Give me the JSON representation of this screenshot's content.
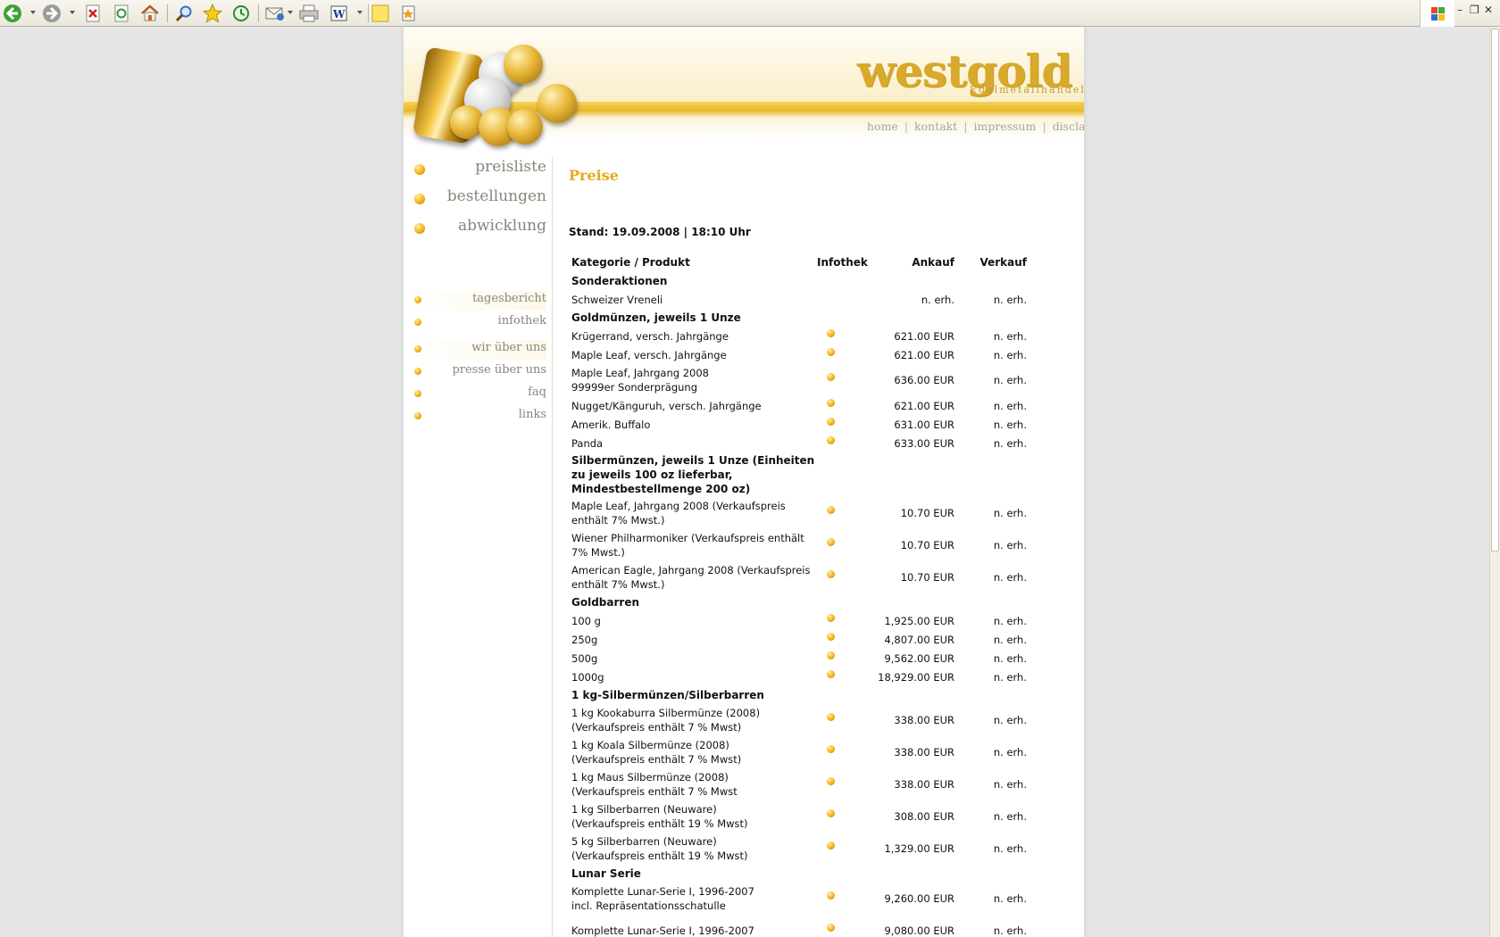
{
  "colors": {
    "accent": "#e4aa16",
    "nav_text": "#8a847a",
    "logo": "#d8a92a"
  },
  "toolbar": {
    "icons": [
      "back-icon",
      "forward-icon",
      "stop-icon",
      "refresh-icon",
      "home-icon",
      "search-icon",
      "favorites-icon",
      "history-icon",
      "mail-icon",
      "print-icon",
      "edit-icon",
      "note-icon",
      "research-icon"
    ]
  },
  "header": {
    "logo": "westgold",
    "logo_sub": "Edelmetallhandel",
    "topnav": [
      "home",
      "kontakt",
      "impressum",
      "disclaimer"
    ]
  },
  "leftnav": {
    "main": [
      "preisliste",
      "bestellungen",
      "abwicklung"
    ],
    "sub1": [
      "tagesbericht",
      "infothek"
    ],
    "sub2": [
      "wir über uns",
      "presse über uns",
      "faq",
      "links"
    ]
  },
  "content": {
    "title": "Preise",
    "stand": "Stand: 19.09.2008 | 18:10 Uhr",
    "columns": [
      "Kategorie / Produkt",
      "Infothek",
      "Ankauf",
      "Verkauf"
    ],
    "rows": [
      {
        "type": "cat",
        "product": "Sonderaktionen"
      },
      {
        "type": "item",
        "product": "Schweizer Vreneli",
        "info": false,
        "ankauf": "n. erh.",
        "verkauf": "n. erh."
      },
      {
        "type": "cat",
        "product": "Goldmünzen, jeweils 1 Unze"
      },
      {
        "type": "item",
        "product": "Krügerrand, versch. Jahrgänge",
        "info": true,
        "ankauf": "621.00 EUR",
        "verkauf": "n. erh."
      },
      {
        "type": "item",
        "product": "Maple Leaf, versch. Jahrgänge",
        "info": true,
        "ankauf": "621.00 EUR",
        "verkauf": "n. erh."
      },
      {
        "type": "item2",
        "product": "Maple Leaf, Jahrgang 2008\n99999er Sonderprägung",
        "info": true,
        "ankauf": "636.00 EUR",
        "verkauf": "n. erh."
      },
      {
        "type": "item",
        "product": "Nugget/Känguruh, versch. Jahrgänge",
        "info": true,
        "ankauf": "621.00 EUR",
        "verkauf": "n. erh."
      },
      {
        "type": "item",
        "product": "Amerik. Buffalo",
        "info": true,
        "ankauf": "631.00 EUR",
        "verkauf": "n. erh."
      },
      {
        "type": "item",
        "product": "Panda",
        "info": true,
        "ankauf": "633.00 EUR",
        "verkauf": "n. erh."
      },
      {
        "type": "cat3",
        "product": "Silbermünzen, jeweils 1 Unze (Einheiten\nzu jeweils 100 oz lieferbar,\nMindestbestellmenge 200 oz)"
      },
      {
        "type": "item2",
        "product": "Maple Leaf, Jahrgang 2008 (Verkaufspreis\nenthält 7% Mwst.)",
        "info": true,
        "ankauf": "10.70 EUR",
        "verkauf": "n. erh."
      },
      {
        "type": "item2",
        "product": "Wiener Philharmoniker (Verkaufspreis enthält\n7% Mwst.)",
        "info": true,
        "ankauf": "10.70 EUR",
        "verkauf": "n. erh."
      },
      {
        "type": "item2",
        "product": "American Eagle, Jahrgang 2008 (Verkaufspreis\nenthält 7% Mwst.)",
        "info": true,
        "ankauf": "10.70 EUR",
        "verkauf": "n. erh."
      },
      {
        "type": "cat",
        "product": "Goldbarren"
      },
      {
        "type": "item",
        "product": "100 g",
        "info": true,
        "ankauf": "1,925.00 EUR",
        "verkauf": "n. erh."
      },
      {
        "type": "item",
        "product": "250g",
        "info": true,
        "ankauf": "4,807.00 EUR",
        "verkauf": "n. erh."
      },
      {
        "type": "item",
        "product": "500g",
        "info": true,
        "ankauf": "9,562.00 EUR",
        "verkauf": "n. erh."
      },
      {
        "type": "item",
        "product": "1000g",
        "info": true,
        "ankauf": "18,929.00 EUR",
        "verkauf": "n. erh."
      },
      {
        "type": "cat",
        "product": "1 kg-Silbermünzen/Silberbarren"
      },
      {
        "type": "item2",
        "product": "1 kg Kookaburra Silbermünze (2008)\n(Verkaufspreis enthält 7 % Mwst)",
        "info": true,
        "ankauf": "338.00 EUR",
        "verkauf": "n. erh."
      },
      {
        "type": "item2",
        "product": "1 kg Koala Silbermünze (2008)\n(Verkaufspreis enthält 7 % Mwst)",
        "info": true,
        "ankauf": "338.00 EUR",
        "verkauf": "n. erh."
      },
      {
        "type": "item2",
        "product": "1 kg Maus Silbermünze (2008)\n(Verkaufspreis enthält 7 % Mwst",
        "info": true,
        "ankauf": "338.00 EUR",
        "verkauf": "n. erh."
      },
      {
        "type": "item2",
        "product": "1 kg Silberbarren (Neuware)\n(Verkaufspreis enthält 19 % Mwst)",
        "info": true,
        "ankauf": "308.00 EUR",
        "verkauf": "n. erh."
      },
      {
        "type": "item2",
        "product": "5 kg Silberbarren (Neuware)\n(Verkaufspreis enthält 19 % Mwst)",
        "info": true,
        "ankauf": "1,329.00 EUR",
        "verkauf": "n. erh."
      },
      {
        "type": "cat",
        "product": "Lunar Serie"
      },
      {
        "type": "item2",
        "product": "Komplette Lunar-Serie I, 1996-2007\nincl. Repräsentationsschatulle",
        "info": true,
        "ankauf": "9,260.00 EUR",
        "verkauf": "n. erh."
      },
      {
        "type": "item2",
        "product": "Komplette Lunar-Serie I, 1996-2007",
        "info": true,
        "ankauf": "9,080.00 EUR",
        "verkauf": "n. erh."
      }
    ]
  }
}
